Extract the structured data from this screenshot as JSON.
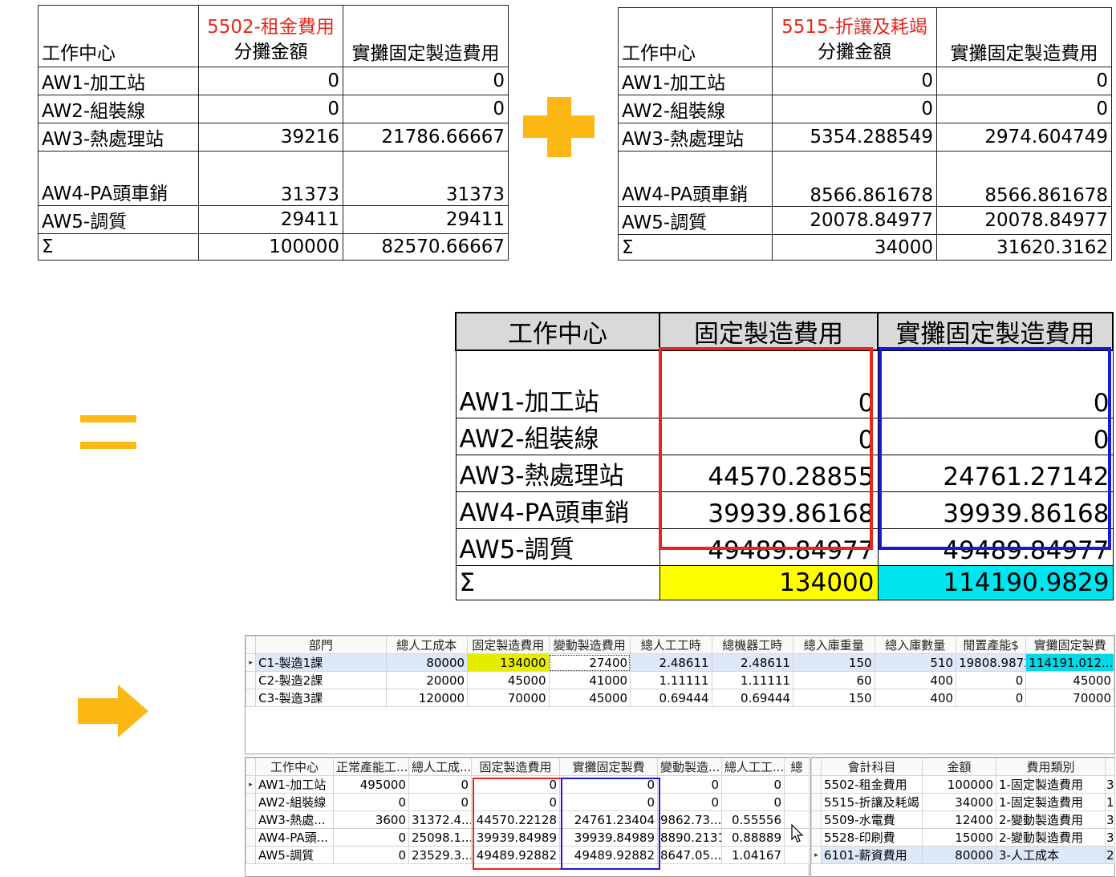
{
  "table1": {
    "account": "5502-租金費用",
    "headers": [
      "工作中心",
      "分攤金額",
      "實攤固定製造費用"
    ],
    "rows": [
      [
        "AW1-加工站",
        "0",
        "0"
      ],
      [
        "AW2-組裝線",
        "0",
        "0"
      ],
      [
        "AW3-熱處理站",
        "39216",
        "21786.66667"
      ],
      [
        "AW4-PA頭車銷",
        "31373",
        "31373"
      ],
      [
        "AW5-調質",
        "29411",
        "29411"
      ],
      [
        "Σ",
        "100000",
        "82570.66667"
      ]
    ]
  },
  "table2": {
    "account": "5515-折讓及耗竭",
    "headers": [
      "工作中心",
      "分攤金額",
      "實攤固定製造費用"
    ],
    "rows": [
      [
        "AW1-加工站",
        "0",
        "0"
      ],
      [
        "AW2-組裝線",
        "0",
        "0"
      ],
      [
        "AW3-熱處理站",
        "5354.288549",
        "2974.604749"
      ],
      [
        "AW4-PA頭車銷",
        "8566.861678",
        "8566.861678"
      ],
      [
        "AW5-調質",
        "20078.84977",
        "20078.84977"
      ],
      [
        "Σ",
        "34000",
        "31620.3162"
      ]
    ]
  },
  "operators": {
    "plus": "plus-sign",
    "equals": "equals-sign",
    "arrow": "right-arrow"
  },
  "colors": {
    "accent": "#fdb813",
    "red_outline": "#e8271c",
    "blue_outline": "#1a1ad6",
    "yellow": "#ffff00",
    "cyan": "#00e5ee"
  },
  "table3": {
    "headers": [
      "工作中心",
      "固定製造費用",
      "實攤固定製造費用"
    ],
    "rows": [
      [
        "AW1-加工站",
        "0",
        "0"
      ],
      [
        "AW2-組裝線",
        "0",
        "0"
      ],
      [
        "AW3-熱處理站",
        "44570.28855",
        "24761.27142"
      ],
      [
        "AW4-PA頭車銷",
        "39939.86168",
        "39939.86168"
      ],
      [
        "AW5-調質",
        "49489.84977",
        "49489.84977"
      ]
    ],
    "total": [
      "Σ",
      "134000",
      "114190.9829"
    ]
  },
  "dept_grid": {
    "headers": [
      "部門",
      "總人工成本",
      "固定製造費用",
      "變動製造費用",
      "總人工工時",
      "總機器工時",
      "總入庫重量",
      "總入庫數量",
      "閒置產能$",
      "實攤固定製費"
    ],
    "rows": [
      [
        "C1-製造1課",
        "80000",
        "134000",
        "27400",
        "2.48611",
        "2.48611",
        "150",
        "510",
        "19808.98724",
        "114191.012..."
      ],
      [
        "C2-製造2課",
        "20000",
        "45000",
        "41000",
        "1.11111",
        "1.11111",
        "60",
        "400",
        "0",
        "45000"
      ],
      [
        "C3-製造3課",
        "120000",
        "70000",
        "45000",
        "0.69444",
        "0.69444",
        "150",
        "400",
        "0",
        "70000"
      ]
    ]
  },
  "wc_grid": {
    "headers": [
      "工作中心",
      "正常產能工...",
      "總人工成...",
      "固定製造費用",
      "實攤固定製費",
      "變動製造...",
      "總人工工...",
      "總"
    ],
    "rows": [
      [
        "AW1-加工站",
        "495000",
        "0",
        "0",
        "0",
        "0",
        "0"
      ],
      [
        "AW2-組裝線",
        "0",
        "0",
        "0",
        "0",
        "0",
        "0"
      ],
      [
        "AW3-熱處...",
        "3600",
        "31372.4...",
        "44570.22128",
        "24761.23404",
        "9862.73...",
        "0.55556"
      ],
      [
        "AW4-PA頭...",
        "0",
        "25098.1...",
        "39939.84989",
        "39939.84989",
        "8890.2131",
        "0.88889"
      ],
      [
        "AW5-調質",
        "0",
        "23529.3...",
        "49489.92882",
        "49489.92882",
        "8647.05...",
        "1.04167"
      ]
    ]
  },
  "acct_grid": {
    "headers": [
      "會計科目",
      "金額",
      "費用類別"
    ],
    "rows": [
      [
        "5502-租金費用",
        "100000",
        "1-固定製造費用",
        "3"
      ],
      [
        "5515-折讓及耗竭",
        "34000",
        "1-固定製造費用",
        "1"
      ],
      [
        "5509-水電費",
        "12400",
        "2-變動製造費用",
        "3"
      ],
      [
        "5528-印刷費",
        "15000",
        "2-變動製造費用",
        "3"
      ],
      [
        "6101-薪資費用",
        "80000",
        "3-人工成本",
        "2"
      ]
    ]
  }
}
